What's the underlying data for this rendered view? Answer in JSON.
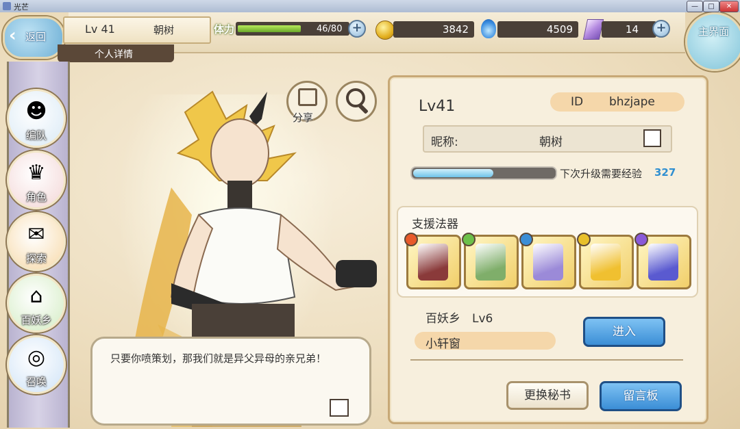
{
  "window": {
    "title": "光芒",
    "min": "—",
    "max": "□",
    "close": "✕"
  },
  "nav": {
    "back_label": "返回",
    "main_menu_label": "主界面"
  },
  "player_plate": {
    "level": "Lv 41",
    "name": "朝树",
    "detail_tab": "个人详情"
  },
  "stamina": {
    "label": "体力",
    "value": "46/80",
    "current": 46,
    "max": 80,
    "plus": "+"
  },
  "currency": {
    "coins": "3842",
    "soul": "4509",
    "gems": "14",
    "plus": "+"
  },
  "left_menu": [
    {
      "label": "编队",
      "icon": "team-icon",
      "color": "#d9e9f5"
    },
    {
      "label": "角色",
      "icon": "character-icon",
      "color": "#f3d6d6"
    },
    {
      "label": "探索",
      "icon": "explore-icon",
      "color": "#f7d9a8"
    },
    {
      "label": "百妖乡",
      "icon": "village-icon",
      "color": "#d3ecc3"
    },
    {
      "label": "召唤",
      "icon": "summon-icon",
      "color": "#cfe3f7"
    }
  ],
  "character": {
    "share_label": "分享"
  },
  "dialogue": {
    "text": "只要你喷策划，那我们就是异父异母的亲兄弟！"
  },
  "profile": {
    "level": "Lv41",
    "id_label": "ID",
    "id_value": "bhzjape",
    "nickname_label": "昵称:",
    "nickname": "朝树",
    "exp_fraction": 0.57,
    "exp_label": "下次升级需要经验",
    "exp_value": "327",
    "support_title": "支援法器",
    "support_items": [
      {
        "name": "fan-artifact",
        "element": "#e85a2a",
        "art": "#8a3a3a"
      },
      {
        "name": "ring-artifact",
        "element": "#6cc04a",
        "art": "#7fae6a"
      },
      {
        "name": "blade-artifact",
        "element": "#3b8ed6",
        "art": "#9b8ad8"
      },
      {
        "name": "horn-artifact",
        "element": "#e8c02a",
        "art": "#f0c030"
      },
      {
        "name": "sword-artifact",
        "element": "#8a5ad8",
        "art": "#5a5ad0"
      }
    ],
    "village": "百妖乡　Lv6",
    "village_window": "小轩窗",
    "enter_label": "进入",
    "swap_label": "更换秘书",
    "board_label": "留言板"
  }
}
